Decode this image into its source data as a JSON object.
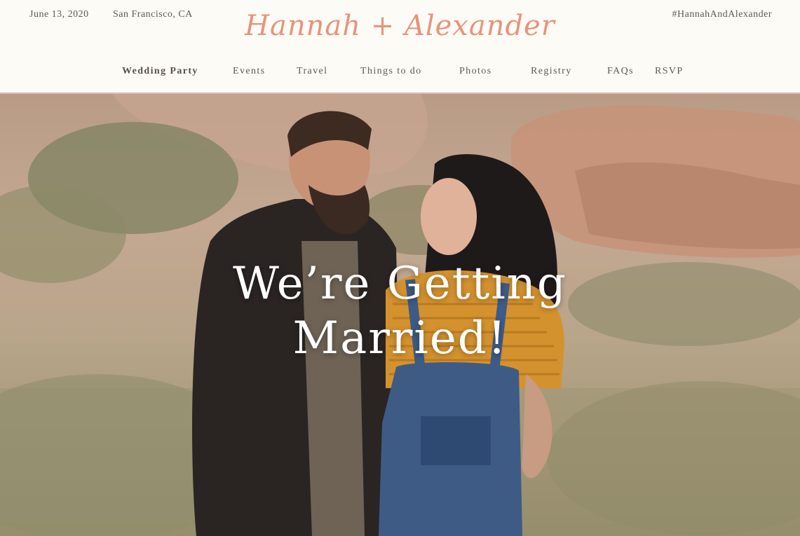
{
  "header": {
    "date": "June 13, 2020",
    "location": "San Francisco, CA",
    "hashtag": "#HannahAndAlexander",
    "logo_text": "Hannah + Alexander"
  },
  "nav": {
    "items": [
      {
        "label": "Wedding Party",
        "active": true
      },
      {
        "label": "Events",
        "active": false
      },
      {
        "label": "Travel",
        "active": false
      },
      {
        "label": "Things to do",
        "active": false
      },
      {
        "label": "Photos",
        "active": false
      },
      {
        "label": "Registry",
        "active": false
      },
      {
        "label": "FAQs",
        "active": false
      },
      {
        "label": "RSVP",
        "active": false
      }
    ]
  },
  "hero": {
    "title_line1": "We’re Getting",
    "title_line2": "Married!",
    "image_description": "engaged-couple-photo"
  },
  "colors": {
    "background": "#fdfbf6",
    "accent": "#e8937c",
    "nav_text": "#5c5a55",
    "header_border": "#e6b9aa"
  }
}
